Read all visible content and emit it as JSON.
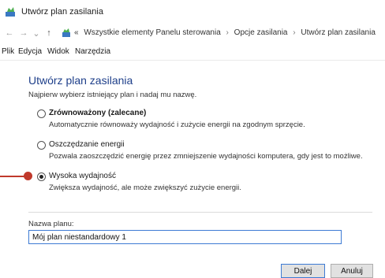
{
  "window": {
    "title": "Utwórz plan zasilania",
    "icon": "control-panel-icon"
  },
  "address": {
    "nav": {
      "back": "←",
      "forward": "→",
      "recent": "⌄",
      "up": "↑"
    },
    "crumbs": [
      "«",
      "Wszystkie elementy Panelu sterowania",
      "Opcje zasilania",
      "Utwórz plan zasilania"
    ],
    "separator": "›"
  },
  "menu": [
    "Plik",
    "Edycja",
    "Widok",
    "Narzędzia"
  ],
  "content": {
    "heading": "Utwórz plan zasilania",
    "instruction": "Najpierw wybierz istniejący plan i nadaj mu nazwę.",
    "options": [
      {
        "label": "Zrównoważony (zalecane)",
        "description": "Automatycznie równoważy wydajność i zużycie energii na zgodnym sprzęcie.",
        "checked": false,
        "bold": true
      },
      {
        "label": "Oszczędzanie energii",
        "description": "Pozwala zaoszczędzić energię przez zmniejszenie wydajności komputera, gdy jest to możliwe.",
        "checked": false,
        "bold": false
      },
      {
        "label": "Wysoka wydajność",
        "description": "Zwiększa wydajność, ale może zwiększyć zużycie energii.",
        "checked": true,
        "bold": false
      }
    ],
    "plan_name": {
      "label": "Nazwa planu:",
      "value": "Mój plan niestandardowy 1"
    },
    "buttons": {
      "next": "Dalej",
      "cancel": "Anuluj"
    }
  },
  "colors": {
    "heading": "#1e3f8a",
    "callout": "#c0392b",
    "focus_border": "#3d7bd4"
  }
}
